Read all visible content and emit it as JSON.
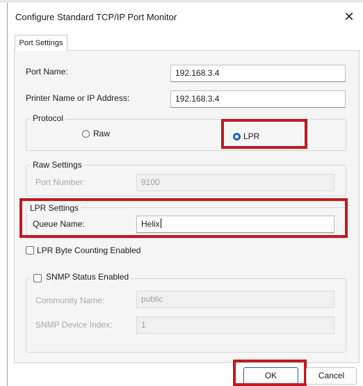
{
  "window": {
    "title": "Configure Standard TCP/IP Port Monitor",
    "close_glyph": "✕"
  },
  "tabs": [
    {
      "label": "Port Settings",
      "selected": true
    }
  ],
  "port_name": {
    "label": "Port Name:",
    "value": "192.168.3.4"
  },
  "printer_address": {
    "label": "Printer Name or IP Address:",
    "value": "192.168.3.4"
  },
  "protocol": {
    "legend": "Protocol",
    "options": [
      {
        "label": "Raw",
        "selected": false
      },
      {
        "label": "LPR",
        "selected": true
      }
    ]
  },
  "raw_settings": {
    "legend": "Raw Settings",
    "port_number_label": "Port Number:",
    "port_number_value": "9100",
    "enabled": false
  },
  "lpr_settings": {
    "legend": "LPR Settings",
    "queue_name_label": "Queue Name:",
    "queue_name_value": "Helix",
    "byte_counting_label": "LPR Byte Counting Enabled",
    "byte_counting_checked": false
  },
  "snmp": {
    "enabled_label": "SNMP Status Enabled",
    "enabled_checked": false,
    "community_label": "Community Name:",
    "community_value": "public",
    "device_index_label": "SNMP Device Index:",
    "device_index_value": "1"
  },
  "buttons": {
    "ok": "OK",
    "cancel": "Cancel"
  },
  "colors": {
    "highlight": "#c11820",
    "accent": "#1760c8",
    "panel_bg": "#f5f5f5",
    "disabled_text": "#a8a8a8"
  }
}
